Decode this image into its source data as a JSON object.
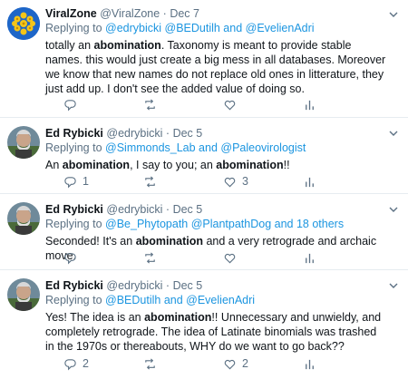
{
  "tweets": [
    {
      "name": "ViralZone",
      "handle": "@ViralZone",
      "sep": "·",
      "date": "Dec 7",
      "reply_prefix": "Replying to",
      "reply_mentions": "@edrybicki @BEDutilh and @EvelienAdri",
      "text_html": "totally an <b>abomination</b>. Taxonomy is meant to provide stable names. this would just create a big mess in all databases. Moreover we know that new names do not replace old ones in litterature, they just add up. I don't see the added value of doing so.",
      "reply_count": "",
      "retweet_count": "",
      "like_count": ""
    },
    {
      "name": "Ed Rybicki",
      "handle": "@edrybicki",
      "sep": "·",
      "date": "Dec 5",
      "reply_prefix": "Replying to",
      "reply_mentions": "@Simmonds_Lab and @Paleovirologist",
      "text_html": "An <b>abomination</b>, I say to you; an <b>abomination</b>!!",
      "reply_count": "1",
      "retweet_count": "",
      "like_count": "3"
    },
    {
      "name": "Ed Rybicki",
      "handle": "@edrybicki",
      "sep": "·",
      "date": "Dec 5",
      "reply_prefix": "Replying to",
      "reply_mentions": "@Be_Phytopath @PlantpathDog and 18 others",
      "text_html": "Seconded! It's an <b>abomination</b> and a very retrograde and archaic move.",
      "reply_count": "",
      "retweet_count": "",
      "like_count": ""
    },
    {
      "name": "Ed Rybicki",
      "handle": "@edrybicki",
      "sep": "·",
      "date": "Dec 5",
      "reply_prefix": "Replying to",
      "reply_mentions": "@BEDutilh and @EvelienAdri",
      "text_html": "Yes! The idea is an <b>abomination</b>!! Unnecessary and unwieldy, and completely retrograde. The idea of Latinate binomials was trashed in the 1970s or thereabouts, WHY do we want to go back??",
      "reply_count": "2",
      "retweet_count": "",
      "like_count": "2"
    }
  ],
  "colors": {
    "accent": "#1b95e0",
    "muted": "#5b7083",
    "text": "#0f1419"
  },
  "icons": [
    "chevron-down-icon",
    "reply-icon",
    "retweet-icon",
    "like-icon",
    "analytics-icon"
  ]
}
